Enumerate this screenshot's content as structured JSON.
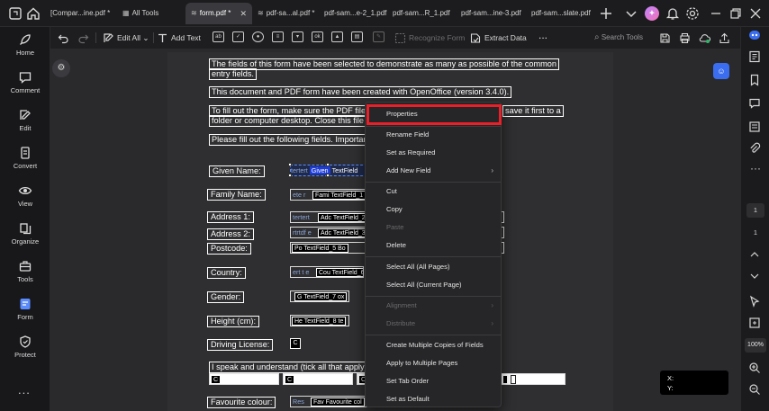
{
  "tabs": [
    {
      "label": "[Compar...ine.pdf *"
    },
    {
      "label": "All Tools"
    },
    {
      "label": "form.pdf *"
    },
    {
      "label": "pdf-sa...al.pdf *"
    },
    {
      "label": "pdf-sam...e-2_1.pdf"
    },
    {
      "label": "pdf-sam...R_1.pdf"
    },
    {
      "label": "pdf-sam...ine-3.pdf"
    },
    {
      "label": "pdf-sam...slate.pdf"
    }
  ],
  "sidebar": {
    "items": [
      {
        "label": "Home"
      },
      {
        "label": "Comment"
      },
      {
        "label": "Edit"
      },
      {
        "label": "Convert"
      },
      {
        "label": "View"
      },
      {
        "label": "Organize"
      },
      {
        "label": "Tools"
      },
      {
        "label": "Form"
      },
      {
        "label": "Protect"
      }
    ],
    "more": "..."
  },
  "toolbar": {
    "edit_all": "Edit All",
    "add_text": "Add Text",
    "recognize_form": "Recognize Form",
    "extract_data": "Extract Data",
    "more": "...",
    "search_tools": "Search Tools"
  },
  "document": {
    "intro_line1": "The fields of this form have been selected to demonstrate as many as possible of the common",
    "intro_line2": "entry fields.",
    "created_with": "This document and PDF form have been created with OpenOffice (version 3.4.0).",
    "fill_line1_start": "To fill out the form, make sure the PDF file",
    "fill_line1_end": "save it first to a",
    "fill_line2": "folder or computer desktop. Close this file",
    "please_fill": "Please fill out the following fields. Importan",
    "labels": {
      "given_name": "Given Name:",
      "family_name": "Family Name:",
      "address1": "Address 1:",
      "address2": "Address 2:",
      "postcode": "Postcode:",
      "country": "Country:",
      "gender": "Gender:",
      "height": "Height (cm):",
      "driving": "Driving License:",
      "languages": "I speak and understand (tick all that apply)",
      "colour": "Favourite colour:"
    },
    "fields": {
      "given_ph": "tertert",
      "given_hl": "Given",
      "given_tag": "TextField",
      "family_ph": "ete r",
      "family_tag": "Fami TextField_1",
      "addr1_ph": "tertert",
      "addr1_tag": "Adc TextField_2",
      "addr2_ph": "rtrtdf e",
      "addr2_tag": "Adc TextField_3",
      "post_tag": "Po TextField_5 Bo",
      "country_ph": "ert t e",
      "country_tag": "Cou TextField_6",
      "gender_tag": "G TextField_7 ox",
      "height_tag": "He TextField_8 te",
      "driving_tag": "C",
      "lang_tag": "C",
      "colour_ph": "Res",
      "colour_tag": "Fav Favourite col"
    }
  },
  "context_menu": {
    "items": [
      {
        "label": "Properties",
        "enabled": true
      },
      {
        "label": "Rename Field",
        "enabled": true
      },
      {
        "label": "Set as Required",
        "enabled": true
      },
      {
        "label": "Add New Field",
        "enabled": true,
        "submenu": true
      },
      {
        "label": "Cut",
        "enabled": true
      },
      {
        "label": "Copy",
        "enabled": true
      },
      {
        "label": "Paste",
        "enabled": false
      },
      {
        "label": "Delete",
        "enabled": true
      },
      {
        "label": "Select All (All Pages)",
        "enabled": true
      },
      {
        "label": "Select All (Current Page)",
        "enabled": true
      },
      {
        "label": "Alignment",
        "enabled": false,
        "submenu": true
      },
      {
        "label": "Distribute",
        "enabled": false,
        "submenu": true
      },
      {
        "label": "Create Multiple Copies of Fields",
        "enabled": true
      },
      {
        "label": "Apply to Multiple Pages",
        "enabled": true
      },
      {
        "label": "Set Tab Order",
        "enabled": true
      },
      {
        "label": "Set as Default",
        "enabled": true
      }
    ],
    "submenu_arrow": "›",
    "highlight_color": "#e8202a"
  },
  "rightbar": {
    "page_current": "1",
    "page_total": "1",
    "zoom": "100%"
  },
  "coords": {
    "x_label": "X:",
    "y_label": "Y:"
  },
  "colors": {
    "accent": "#5b8cff",
    "highlight": "#e8202a",
    "ai_button": "#3a6df0"
  }
}
